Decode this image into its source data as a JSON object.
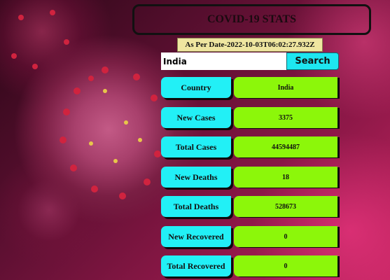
{
  "header": {
    "title": "COVID-19 STATS"
  },
  "date_line": "As Per Date-2022-10-03T06:02:27.932Z",
  "search": {
    "value": "India",
    "button_label": "Search"
  },
  "stats": [
    {
      "label": "Country",
      "value": "India"
    },
    {
      "label": "New Cases",
      "value": "3375"
    },
    {
      "label": "Total Cases",
      "value": "44594487"
    },
    {
      "label": "New Deaths",
      "value": "18"
    },
    {
      "label": "Total Deaths",
      "value": "528673"
    },
    {
      "label": "New Recovered",
      "value": "0"
    },
    {
      "label": "Total Recovered",
      "value": "0"
    }
  ],
  "colors": {
    "label_bg": "#22f0f6",
    "value_bg": "#8cf70a",
    "date_bg": "#efe6a0",
    "button_bg": "#1ee6f0"
  },
  "background_image": "coronavirus-illustration"
}
